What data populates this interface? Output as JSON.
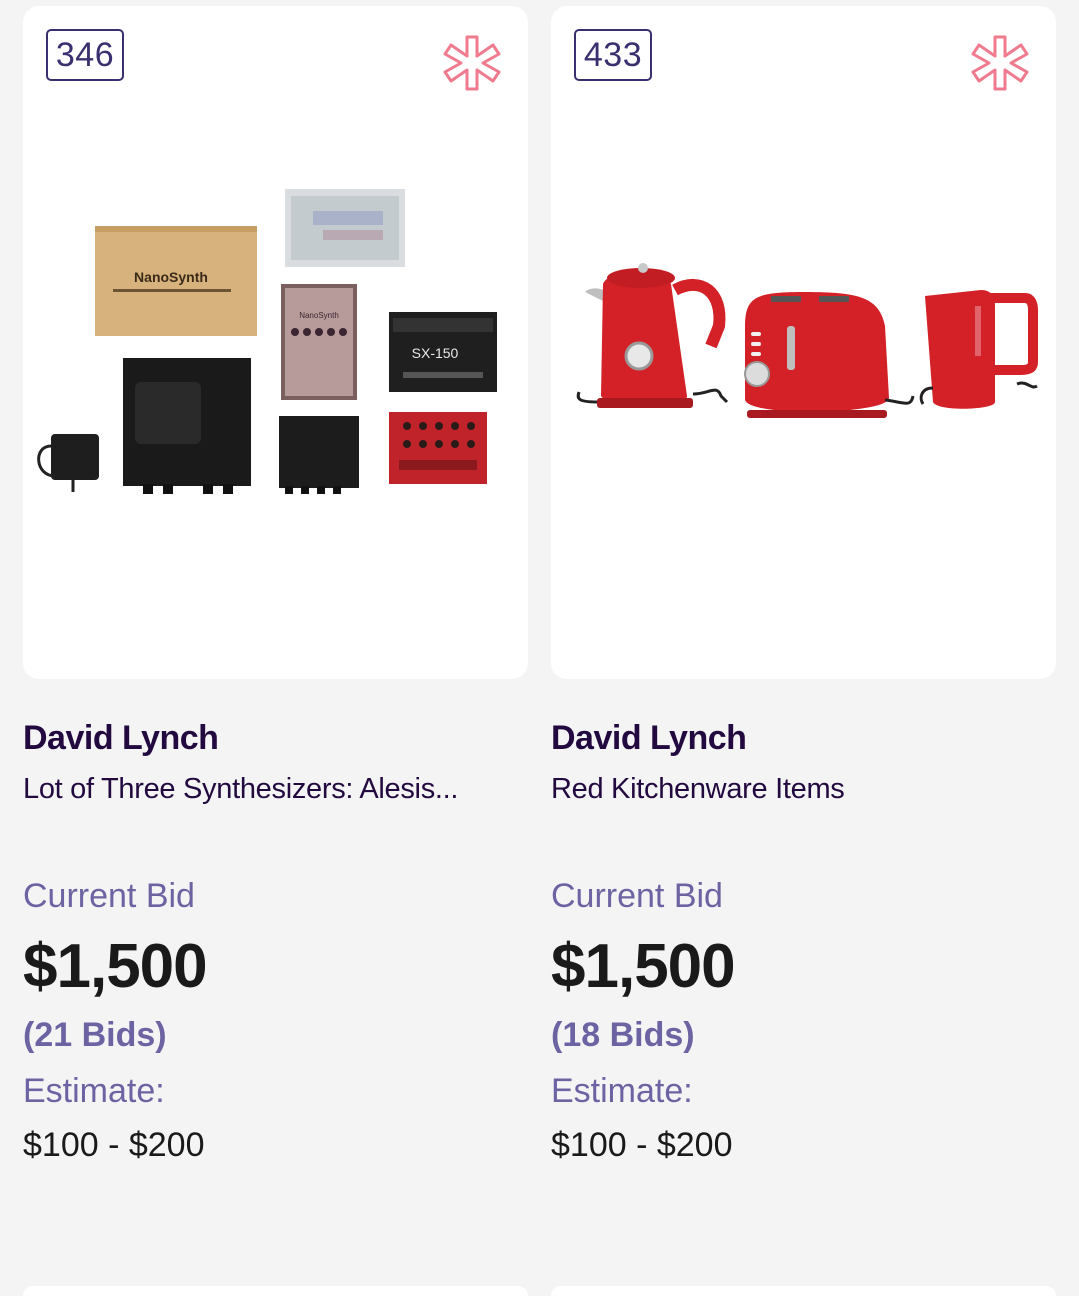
{
  "colors": {
    "accent": "#6c63a3",
    "heading": "#22093f",
    "badge": "#3b2f70",
    "favorite_icon": "#f07a8e",
    "page_bg": "#f4f4f4",
    "card_bg": "#ffffff"
  },
  "lots": [
    {
      "lot_number": "346",
      "favorite_icon": "asterisk-star-outline-icon",
      "image_subject": "synthesizer-lot-photo",
      "seller": "David Lynch",
      "title": "Lot of Three Synthesizers: Alesis...",
      "current_bid_label": "Current Bid",
      "current_bid": "$1,500",
      "bid_count": "(21 Bids)",
      "estimate_label": "Estimate:",
      "estimate": "$100 - $200"
    },
    {
      "lot_number": "433",
      "favorite_icon": "asterisk-star-outline-icon",
      "image_subject": "red-kitchenware-photo",
      "seller": "David Lynch",
      "title": "Red Kitchenware Items",
      "current_bid_label": "Current Bid",
      "current_bid": "$1,500",
      "bid_count": "(18 Bids)",
      "estimate_label": "Estimate:",
      "estimate": "$100 - $200"
    }
  ]
}
